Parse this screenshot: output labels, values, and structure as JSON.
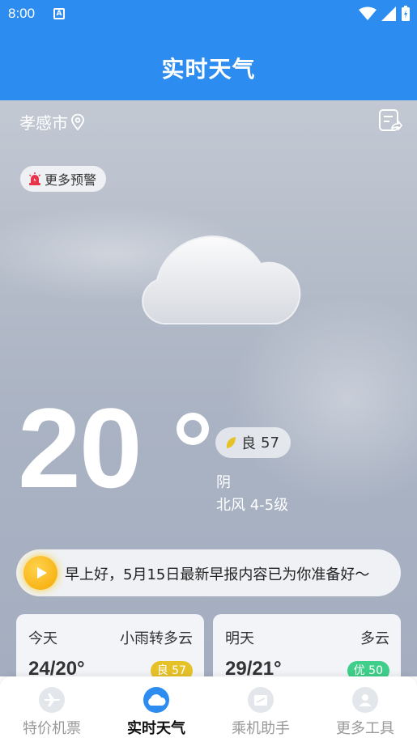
{
  "status_bar": {
    "time": "8:00",
    "notif_letter": "A"
  },
  "header": {
    "title": "实时天气"
  },
  "location": {
    "city": "孝感市"
  },
  "alert": {
    "label": "更多预警"
  },
  "current": {
    "temperature": "20",
    "aqi_label": "良",
    "aqi_value": "57",
    "condition": "阴",
    "wind": "北风 4-5级"
  },
  "briefing": {
    "text": "早上好，5月15日最新早报内容已为你准备好～"
  },
  "forecast": [
    {
      "day": "今天",
      "desc": "小雨转多云",
      "temp": "24/20°",
      "aqi": "良 57",
      "aqi_color": "#e6c229"
    },
    {
      "day": "明天",
      "desc": "多云",
      "temp": "29/21°",
      "aqi": "优 50",
      "aqi_color": "#3fcf8a"
    }
  ],
  "tabs": [
    {
      "label": "特价机票",
      "icon": "plane-icon",
      "active": false
    },
    {
      "label": "实时天气",
      "icon": "cloud-icon",
      "active": true
    },
    {
      "label": "乘机助手",
      "icon": "ticket-icon",
      "active": false
    },
    {
      "label": "更多工具",
      "icon": "user-icon",
      "active": false
    }
  ],
  "colors": {
    "primary": "#2c8cf0"
  }
}
